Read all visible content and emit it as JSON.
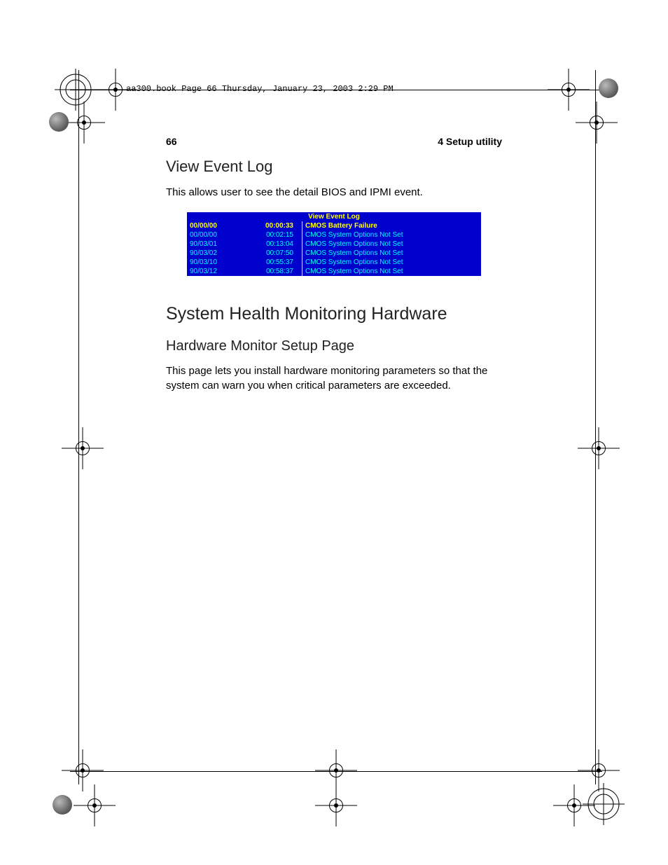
{
  "book_header": "aa300.book  Page 66  Thursday, January 23, 2003  2:29 PM",
  "page_number": "66",
  "section_title": "4 Setup utility",
  "heading_view": "View Event Log",
  "body_view": "This allows user to see the detail BIOS and IPMI event.",
  "event_log": {
    "title": "View Event Log",
    "rows": [
      {
        "date": "00/00/00",
        "time": "00:00:33",
        "msg": "CMOS Battery Failure",
        "hl": true
      },
      {
        "date": "00/00/00",
        "time": "00:02:15",
        "msg": "CMOS System Options Not Set",
        "hl": false
      },
      {
        "date": "90/03/01",
        "time": "00:13:04",
        "msg": "CMOS System Options Not Set",
        "hl": false
      },
      {
        "date": "90/03/02",
        "time": "00:07:50",
        "msg": "CMOS System Options Not Set",
        "hl": false
      },
      {
        "date": "90/03/10",
        "time": "00:55:37",
        "msg": "CMOS System Options Not Set",
        "hl": false
      },
      {
        "date": "90/03/12",
        "time": "00:58:37",
        "msg": "CMOS System Options Not Set",
        "hl": false
      }
    ]
  },
  "heading_sys": "System Health Monitoring Hardware",
  "heading_hw": "Hardware Monitor Setup Page",
  "body_hw": "This page lets you install hardware monitoring parameters so that the system can warn you when critical parameters are exceeded."
}
